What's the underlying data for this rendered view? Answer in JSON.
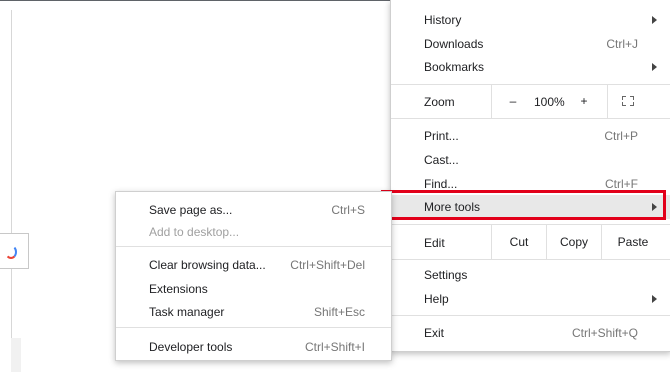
{
  "main_menu": {
    "history": "History",
    "downloads": "Downloads",
    "downloads_shortcut": "Ctrl+J",
    "bookmarks": "Bookmarks",
    "zoom_label": "Zoom",
    "zoom_minus": "–",
    "zoom_value": "100%",
    "zoom_plus": "+",
    "print": "Print...",
    "print_shortcut": "Ctrl+P",
    "cast": "Cast...",
    "find": "Find...",
    "find_shortcut": "Ctrl+F",
    "more_tools": "More tools",
    "edit_label": "Edit",
    "cut": "Cut",
    "copy": "Copy",
    "paste": "Paste",
    "settings": "Settings",
    "help": "Help",
    "exit": "Exit",
    "exit_shortcut": "Ctrl+Shift+Q"
  },
  "submenu": {
    "save_page": "Save page as...",
    "save_page_shortcut": "Ctrl+S",
    "add_desktop": "Add to desktop...",
    "clear_data": "Clear browsing data...",
    "clear_data_shortcut": "Ctrl+Shift+Del",
    "extensions": "Extensions",
    "task_manager": "Task manager",
    "task_manager_shortcut": "Shift+Esc",
    "dev_tools": "Developer tools",
    "dev_tools_shortcut": "Ctrl+Shift+I"
  },
  "colors": {
    "highlight_border": "#e2001a",
    "hover_background": "#e8e8e8"
  },
  "icons": [
    "submenu-arrow-icon",
    "fullscreen-icon",
    "google-logo-icon"
  ]
}
